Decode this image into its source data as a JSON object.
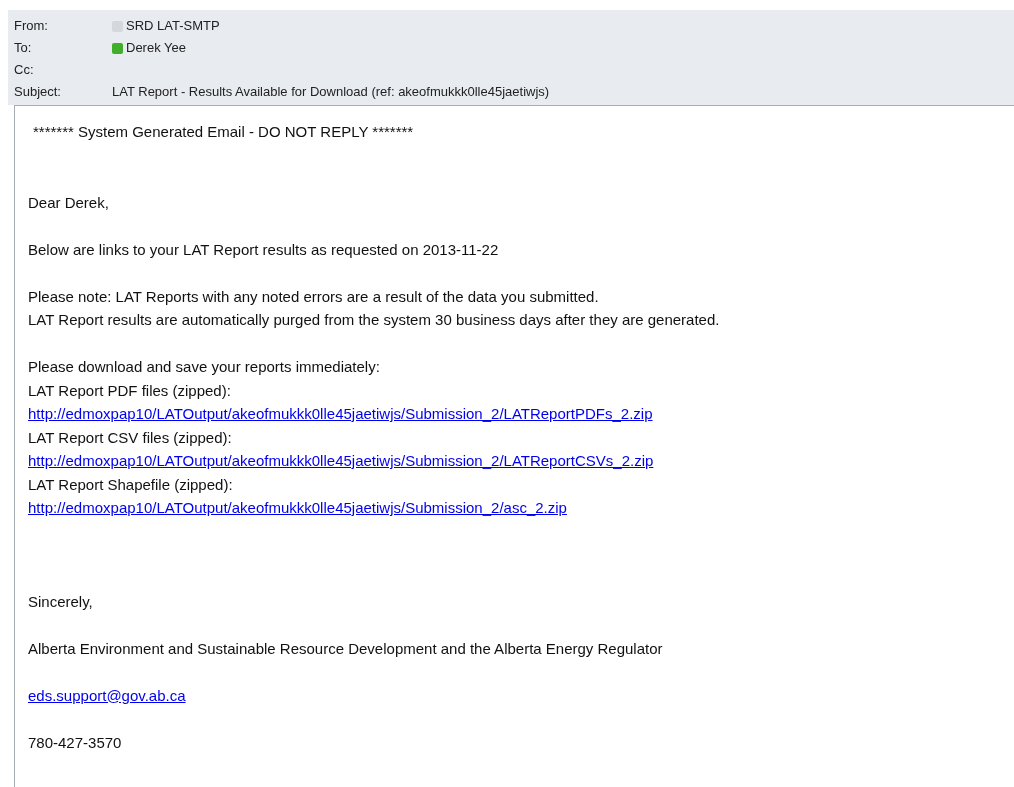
{
  "header": [
    {
      "label": "From:",
      "value": "SRD LAT-SMTP",
      "color": "#d4d8dc"
    },
    {
      "label": "To:",
      "value": "Derek Yee",
      "color": "#3fae2a"
    },
    {
      "label": "Cc:"
    },
    {
      "label": "Subject:",
      "value": "LAT Report - Results Available for Download  (ref: akeofmukkk0lle45jaetiwjs)"
    }
  ],
  "body": [
    {
      "kind": "banner",
      "lines": [
        {
          "kind": "text",
          "text": "******* System Generated Email - DO NOT REPLY *******"
        }
      ]
    },
    {
      "kind": "para",
      "lines": [
        {
          "kind": "text",
          "text": "Dear Derek,"
        }
      ]
    },
    {
      "kind": "para",
      "lines": [
        {
          "kind": "text",
          "text": "Below are links to your LAT Report results as requested on 2013-11-22"
        }
      ]
    },
    {
      "kind": "para",
      "lines": [
        {
          "kind": "text",
          "text": "Please note: LAT Reports with any noted errors are a result of the data you submitted."
        },
        {
          "kind": "text",
          "text": "LAT Report results are automatically purged from the system 30 business days after they are generated."
        }
      ]
    },
    {
      "kind": "links",
      "lines": [
        {
          "kind": "text",
          "text": "Please download and save your reports immediately:"
        },
        {
          "kind": "text",
          "text": "LAT Report PDF files (zipped):"
        },
        {
          "kind": "link",
          "text": "http://edmoxpap10/LATOutput/akeofmukkk0lle45jaetiwjs/Submission_2/LATReportPDFs_2.zip"
        },
        {
          "kind": "text",
          "text": "LAT Report CSV files (zipped):"
        },
        {
          "kind": "link",
          "text": "http://edmoxpap10/LATOutput/akeofmukkk0lle45jaetiwjs/Submission_2/LATReportCSVs_2.zip"
        },
        {
          "kind": "text",
          "text": "LAT Report Shapefile (zipped):"
        },
        {
          "kind": "link",
          "text": "http://edmoxpap10/LATOutput/akeofmukkk0lle45jaetiwjs/Submission_2/asc_2.zip"
        }
      ]
    },
    {
      "kind": "para",
      "lines": [
        {
          "kind": "text",
          "text": "Sincerely,"
        }
      ]
    },
    {
      "kind": "para",
      "lines": [
        {
          "kind": "text",
          "text": "Alberta Environment and Sustainable Resource Development and the Alberta Energy Regulator"
        }
      ]
    },
    {
      "kind": "para",
      "lines": [
        {
          "kind": "link",
          "text": "eds.support@gov.ab.ca"
        }
      ]
    },
    {
      "kind": "para",
      "lines": [
        {
          "kind": "text",
          "text": "780-427-3570"
        }
      ]
    }
  ]
}
